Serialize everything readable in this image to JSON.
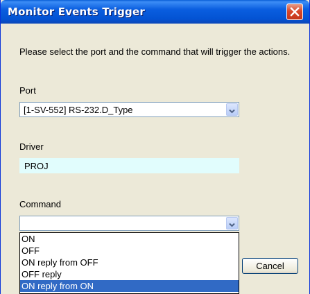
{
  "window": {
    "title": "Monitor Events Trigger"
  },
  "instructions": "Please select the port and the command that will trigger the actions.",
  "port": {
    "label": "Port",
    "value": "[1-SV-552] RS-232.D_Type"
  },
  "driver": {
    "label": "Driver",
    "value": "PROJ"
  },
  "command": {
    "label": "Command",
    "value": "",
    "options": [
      "ON",
      "OFF",
      "ON reply from OFF",
      "OFF reply",
      "ON reply from ON"
    ],
    "highlighted_index": 4
  },
  "buttons": {
    "cancel": "Cancel"
  },
  "colors": {
    "title_bar": "#0a5ed8",
    "selection": "#316ac5",
    "driver_field": "#e1fdfd"
  },
  "icons": {
    "close": "close-icon",
    "dropdown": "chevron-down-icon"
  }
}
